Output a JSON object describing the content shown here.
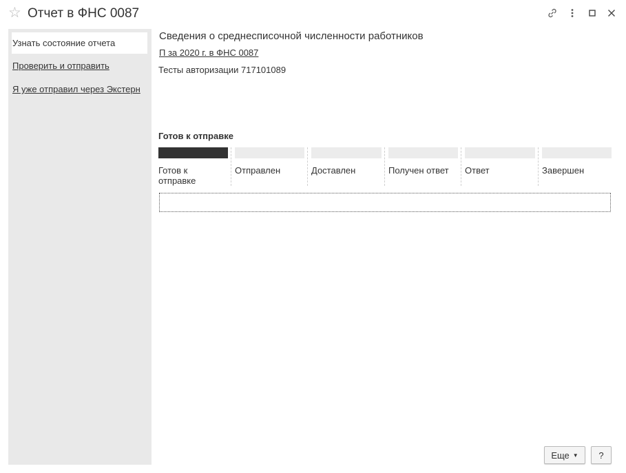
{
  "window": {
    "title": "Отчет в ФНС 0087"
  },
  "sidebar": {
    "items": [
      {
        "label": "Узнать состояние отчета"
      },
      {
        "label": "Проверить и отправить"
      },
      {
        "label": "Я уже отправил через Экстерн"
      }
    ]
  },
  "main": {
    "heading": "Сведения о среднесписочной численности работников",
    "report_link": "П за 2020 г. в ФНС 0087",
    "organization": "Тесты авторизации 717101089",
    "status_title": "Готов к отправке",
    "stages": [
      {
        "label": "Готов к отправке",
        "done": true
      },
      {
        "label": "Отправлен",
        "done": false
      },
      {
        "label": "Доставлен",
        "done": false
      },
      {
        "label": "Получен ответ",
        "done": false
      },
      {
        "label": "Ответ",
        "done": false
      },
      {
        "label": "Завершен",
        "done": false
      }
    ]
  },
  "footer": {
    "more_label": "Еще",
    "help_label": "?"
  },
  "icons": {
    "favorite": "star-icon",
    "link": "link-icon",
    "more": "more-vertical-icon",
    "maximize": "maximize-icon",
    "close": "close-icon",
    "dropdown": "caret-down-icon"
  },
  "colors": {
    "sidebar_bg": "#e9e9e9",
    "stage_done": "#333333",
    "stage_pending": "#ececec"
  }
}
